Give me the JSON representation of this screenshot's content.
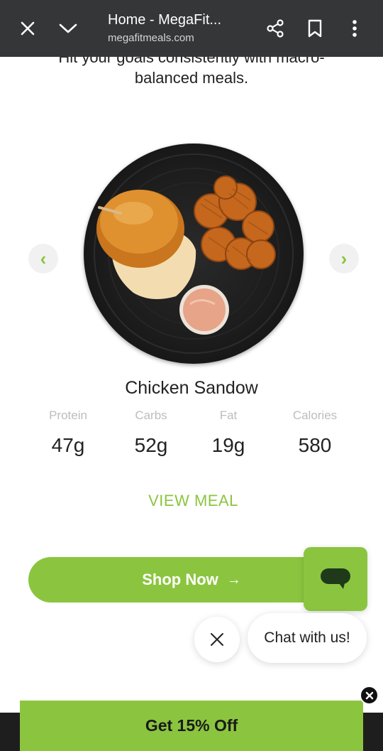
{
  "browser": {
    "title": "Home - MegaFit...",
    "url": "megafitmeals.com",
    "icons": [
      "close-icon",
      "chevron-down-icon",
      "share-icon",
      "bookmark-icon",
      "more-vert-icon"
    ]
  },
  "hero": {
    "subtitle": "Hit your goals consistently with macro-balanced meals."
  },
  "carousel": {
    "prev_symbol": "‹",
    "next_symbol": "›",
    "meal": {
      "name": "Chicken Sandow",
      "macros": [
        {
          "label": "Protein",
          "value": "47g"
        },
        {
          "label": "Carbs",
          "value": "52g"
        },
        {
          "label": "Fat",
          "value": "19g"
        },
        {
          "label": "Calories",
          "value": "580"
        }
      ],
      "view_label": "VIEW MEAL"
    }
  },
  "cta": {
    "shop_label": "Shop Now",
    "shop_arrow": "→"
  },
  "chat": {
    "bubble_text": "Chat with us!"
  },
  "promo": {
    "label": "Get 15% Off"
  },
  "colors": {
    "accent": "#8bc53f",
    "topbar": "#353638"
  }
}
